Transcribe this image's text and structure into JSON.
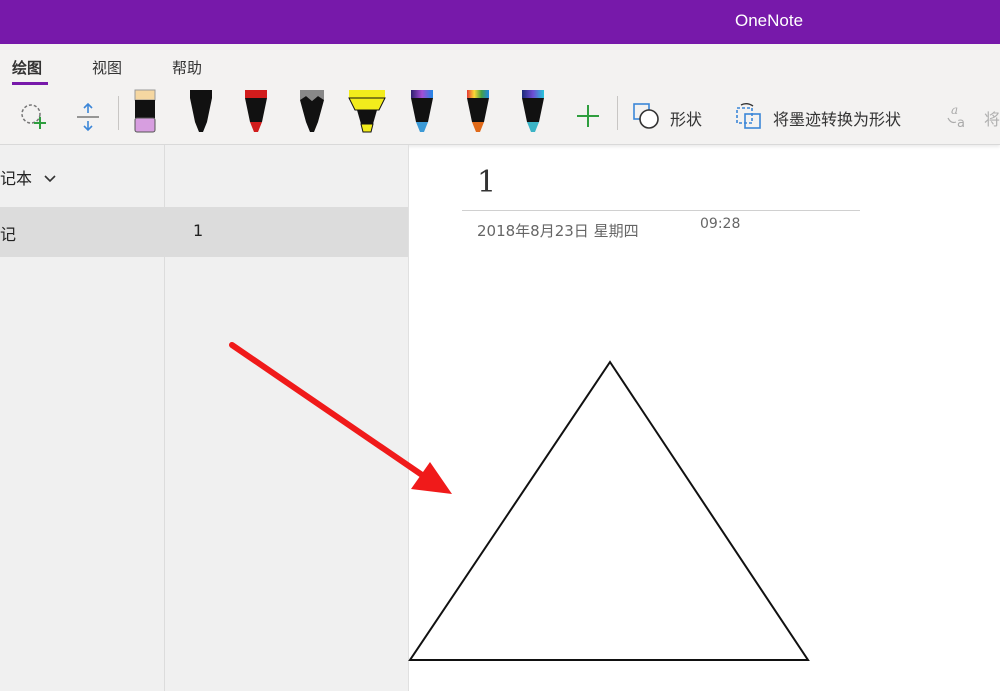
{
  "app": {
    "title": "OneNote"
  },
  "tabs": [
    {
      "label": "绘图",
      "active": true
    },
    {
      "label": "视图",
      "active": false
    },
    {
      "label": "帮助",
      "active": false
    }
  ],
  "toolbar": {
    "shape_label": "形状",
    "ink_to_shape_label": "将墨迹转换为形状",
    "ink_to_text_label": "将"
  },
  "navigation": {
    "notebook_name": "记本",
    "section_label": "记",
    "page_label": "1"
  },
  "page": {
    "title": "1",
    "date": "2018年8月23日 星期四",
    "time": "09:28"
  },
  "colors": {
    "accent": "#7719aa",
    "annotation_arrow": "#f01a1a"
  }
}
